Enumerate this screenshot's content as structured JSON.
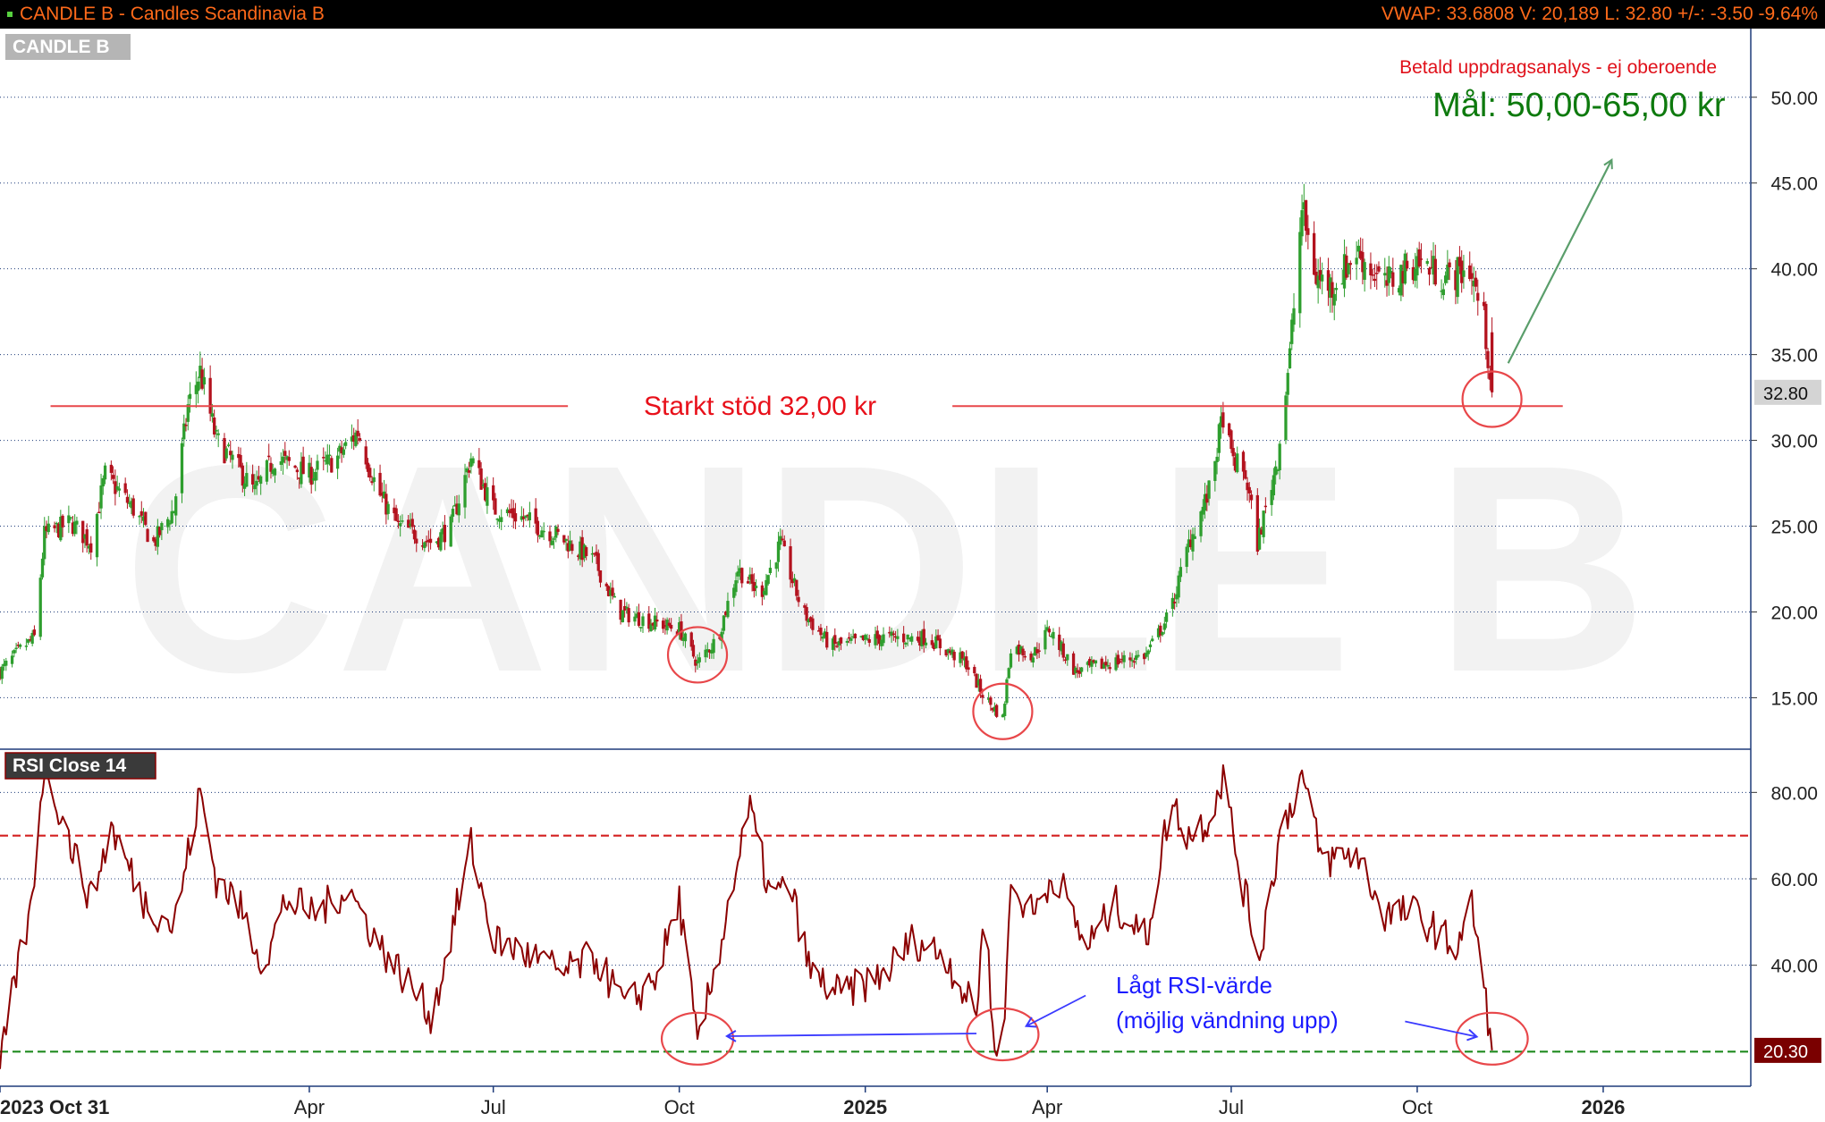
{
  "header": {
    "title": "CANDLE B - Candles Scandinavia B",
    "stats": "VWAP: 33.6808  V: 20,189  L: 32.80  +/-: -3.50  -9.64%"
  },
  "colors": {
    "up": "#2e9e2e",
    "down": "#b3121e",
    "support_line": "#e8474a",
    "target_arrow": "#5a9e6b",
    "rsi_line": "#8b0000",
    "overbought": "#d42020",
    "oversold": "#1f8a1f",
    "annotation_blue": "#1a1aff"
  },
  "chart_data": [
    {
      "type": "candlestick",
      "legend_label": "CANDLE B",
      "watermark": "CANDLE B",
      "notice": "Betald uppdragsanalys - ej oberoende",
      "target_label": "Mål: 50,00-65,00 kr",
      "support_label": "Starkt stöd 32,00 kr",
      "support_level": 32,
      "last_price_label": "32.80",
      "last_price": 32.8,
      "ylim": [
        12,
        54
      ],
      "yticks": [
        15,
        20,
        25,
        30,
        35,
        40,
        45,
        50
      ],
      "ytick_labels": [
        "15.00",
        "20.00",
        "25.00",
        "30.00",
        "35.00",
        "40.00",
        "45.00",
        "50.00"
      ],
      "x_labels": [
        "2023 Oct 31",
        "Apr",
        "Jul",
        "Oct",
        "2025",
        "Apr",
        "Jul",
        "Oct",
        "2026"
      ],
      "x_label_dates": [
        "2023-10-31",
        "2024-04-01",
        "2024-07-01",
        "2024-10-01",
        "2025-01-01",
        "2025-04-01",
        "2025-07-01",
        "2025-10-01",
        "2026-01-01"
      ],
      "xlim": [
        "2023-10-31",
        "2026-03-15"
      ],
      "grid": "horizontal dotted",
      "highlight_circles": [
        "2024-10-10",
        "2025-03-10",
        "2025-11-07"
      ],
      "anchors": [
        [
          "2023-10-31",
          16.5
        ],
        [
          "2023-11-10",
          17.8
        ],
        [
          "2023-11-17",
          18.5
        ],
        [
          "2023-11-22",
          24.5
        ],
        [
          "2023-12-05",
          25.2
        ],
        [
          "2023-12-15",
          24.0
        ],
        [
          "2023-12-22",
          28.0
        ],
        [
          "2024-01-05",
          26.0
        ],
        [
          "2024-01-15",
          24.0
        ],
        [
          "2024-01-25",
          26.0
        ],
        [
          "2024-02-01",
          32.0
        ],
        [
          "2024-02-07",
          34.0
        ],
        [
          "2024-02-15",
          30.0
        ],
        [
          "2024-02-25",
          28.5
        ],
        [
          "2024-03-05",
          27.0
        ],
        [
          "2024-03-15",
          29.0
        ],
        [
          "2024-04-01",
          28.0
        ],
        [
          "2024-04-15",
          29.0
        ],
        [
          "2024-04-25",
          30.5
        ],
        [
          "2024-05-05",
          27.0
        ],
        [
          "2024-05-15",
          25.0
        ],
        [
          "2024-05-25",
          24.5
        ],
        [
          "2024-06-01",
          24.0
        ],
        [
          "2024-06-10",
          25.0
        ],
        [
          "2024-06-20",
          29.0
        ],
        [
          "2024-07-01",
          26.0
        ],
        [
          "2024-07-15",
          25.5
        ],
        [
          "2024-08-01",
          24.5
        ],
        [
          "2024-08-20",
          23.0
        ],
        [
          "2024-09-01",
          20.0
        ],
        [
          "2024-09-15",
          19.5
        ],
        [
          "2024-10-01",
          19.0
        ],
        [
          "2024-10-10",
          17.0
        ],
        [
          "2024-10-20",
          18.5
        ],
        [
          "2024-10-30",
          22.5
        ],
        [
          "2024-11-10",
          21.0
        ],
        [
          "2024-11-20",
          24.0
        ],
        [
          "2024-12-01",
          20.0
        ],
        [
          "2024-12-15",
          18.0
        ],
        [
          "2025-01-10",
          18.5
        ],
        [
          "2025-02-01",
          18.5
        ],
        [
          "2025-02-20",
          17.0
        ],
        [
          "2025-03-01",
          15.0
        ],
        [
          "2025-03-10",
          13.8
        ],
        [
          "2025-03-14",
          18.0
        ],
        [
          "2025-03-25",
          17.5
        ],
        [
          "2025-04-02",
          19.0
        ],
        [
          "2025-04-15",
          16.5
        ],
        [
          "2025-05-01",
          17.0
        ],
        [
          "2025-05-20",
          17.5
        ],
        [
          "2025-06-01",
          20.0
        ],
        [
          "2025-06-10",
          24.0
        ],
        [
          "2025-06-20",
          27.0
        ],
        [
          "2025-06-27",
          31.5
        ],
        [
          "2025-07-01",
          29.0
        ],
        [
          "2025-07-08",
          28.0
        ],
        [
          "2025-07-14",
          24.0
        ],
        [
          "2025-07-24",
          29.0
        ],
        [
          "2025-07-30",
          35.0
        ],
        [
          "2025-08-05",
          43.5
        ],
        [
          "2025-08-12",
          39.5
        ],
        [
          "2025-08-20",
          39.0
        ],
        [
          "2025-09-01",
          41.0
        ],
        [
          "2025-09-15",
          39.0
        ],
        [
          "2025-10-01",
          40.5
        ],
        [
          "2025-10-15",
          39.5
        ],
        [
          "2025-10-27",
          40.0
        ],
        [
          "2025-11-03",
          37.0
        ],
        [
          "2025-11-07",
          32.8
        ]
      ]
    },
    {
      "type": "line",
      "legend_label": "RSI  Close 14",
      "last_value_label": "20.30",
      "last_value": 20.3,
      "ylim": [
        12,
        90
      ],
      "yticks": [
        40,
        60,
        80
      ],
      "ytick_labels": [
        "40.00",
        "60.00",
        "80.00"
      ],
      "overbought": 70,
      "oversold": 20,
      "annotation": [
        "Lågt RSI-värde",
        "(möjlig vändning upp)"
      ],
      "highlight_circles": [
        "2024-10-10",
        "2025-03-10",
        "2025-11-07"
      ],
      "anchors": [
        [
          "2023-10-31",
          16
        ],
        [
          "2023-11-08",
          38
        ],
        [
          "2023-11-15",
          52
        ],
        [
          "2023-11-22",
          87
        ],
        [
          "2023-12-05",
          68
        ],
        [
          "2023-12-15",
          55
        ],
        [
          "2023-12-25",
          72
        ],
        [
          "2024-01-10",
          55
        ],
        [
          "2024-01-25",
          49
        ],
        [
          "2024-02-07",
          80
        ],
        [
          "2024-02-15",
          60
        ],
        [
          "2024-02-25",
          55
        ],
        [
          "2024-03-10",
          40
        ],
        [
          "2024-03-20",
          55
        ],
        [
          "2024-04-05",
          52
        ],
        [
          "2024-04-20",
          58
        ],
        [
          "2024-05-05",
          45
        ],
        [
          "2024-05-20",
          36
        ],
        [
          "2024-06-01",
          28
        ],
        [
          "2024-06-20",
          68
        ],
        [
          "2024-07-01",
          46
        ],
        [
          "2024-07-20",
          42
        ],
        [
          "2024-08-05",
          38
        ],
        [
          "2024-08-20",
          42
        ],
        [
          "2024-09-05",
          30
        ],
        [
          "2024-09-20",
          38
        ],
        [
          "2024-10-01",
          55
        ],
        [
          "2024-10-10",
          21
        ],
        [
          "2024-10-20",
          42
        ],
        [
          "2024-10-28",
          60
        ],
        [
          "2024-11-05",
          76
        ],
        [
          "2024-11-15",
          56
        ],
        [
          "2024-11-25",
          58
        ],
        [
          "2024-12-05",
          38
        ],
        [
          "2024-12-20",
          33
        ],
        [
          "2025-01-10",
          38
        ],
        [
          "2025-01-25",
          46
        ],
        [
          "2025-02-10",
          42
        ],
        [
          "2025-02-25",
          28
        ],
        [
          "2025-03-01",
          58
        ],
        [
          "2025-03-05",
          24
        ],
        [
          "2025-03-10",
          22
        ],
        [
          "2025-03-14",
          58
        ],
        [
          "2025-03-25",
          52
        ],
        [
          "2025-04-05",
          62
        ],
        [
          "2025-04-20",
          44
        ],
        [
          "2025-05-05",
          54
        ],
        [
          "2025-05-20",
          46
        ],
        [
          "2025-06-01",
          78
        ],
        [
          "2025-06-10",
          70
        ],
        [
          "2025-06-20",
          74
        ],
        [
          "2025-06-27",
          84
        ],
        [
          "2025-07-05",
          62
        ],
        [
          "2025-07-15",
          42
        ],
        [
          "2025-07-25",
          70
        ],
        [
          "2025-08-05",
          84
        ],
        [
          "2025-08-15",
          64
        ],
        [
          "2025-09-01",
          66
        ],
        [
          "2025-09-15",
          52
        ],
        [
          "2025-10-01",
          52
        ],
        [
          "2025-10-20",
          44
        ],
        [
          "2025-10-28",
          54
        ],
        [
          "2025-11-01",
          42
        ],
        [
          "2025-11-07",
          20
        ]
      ]
    }
  ]
}
